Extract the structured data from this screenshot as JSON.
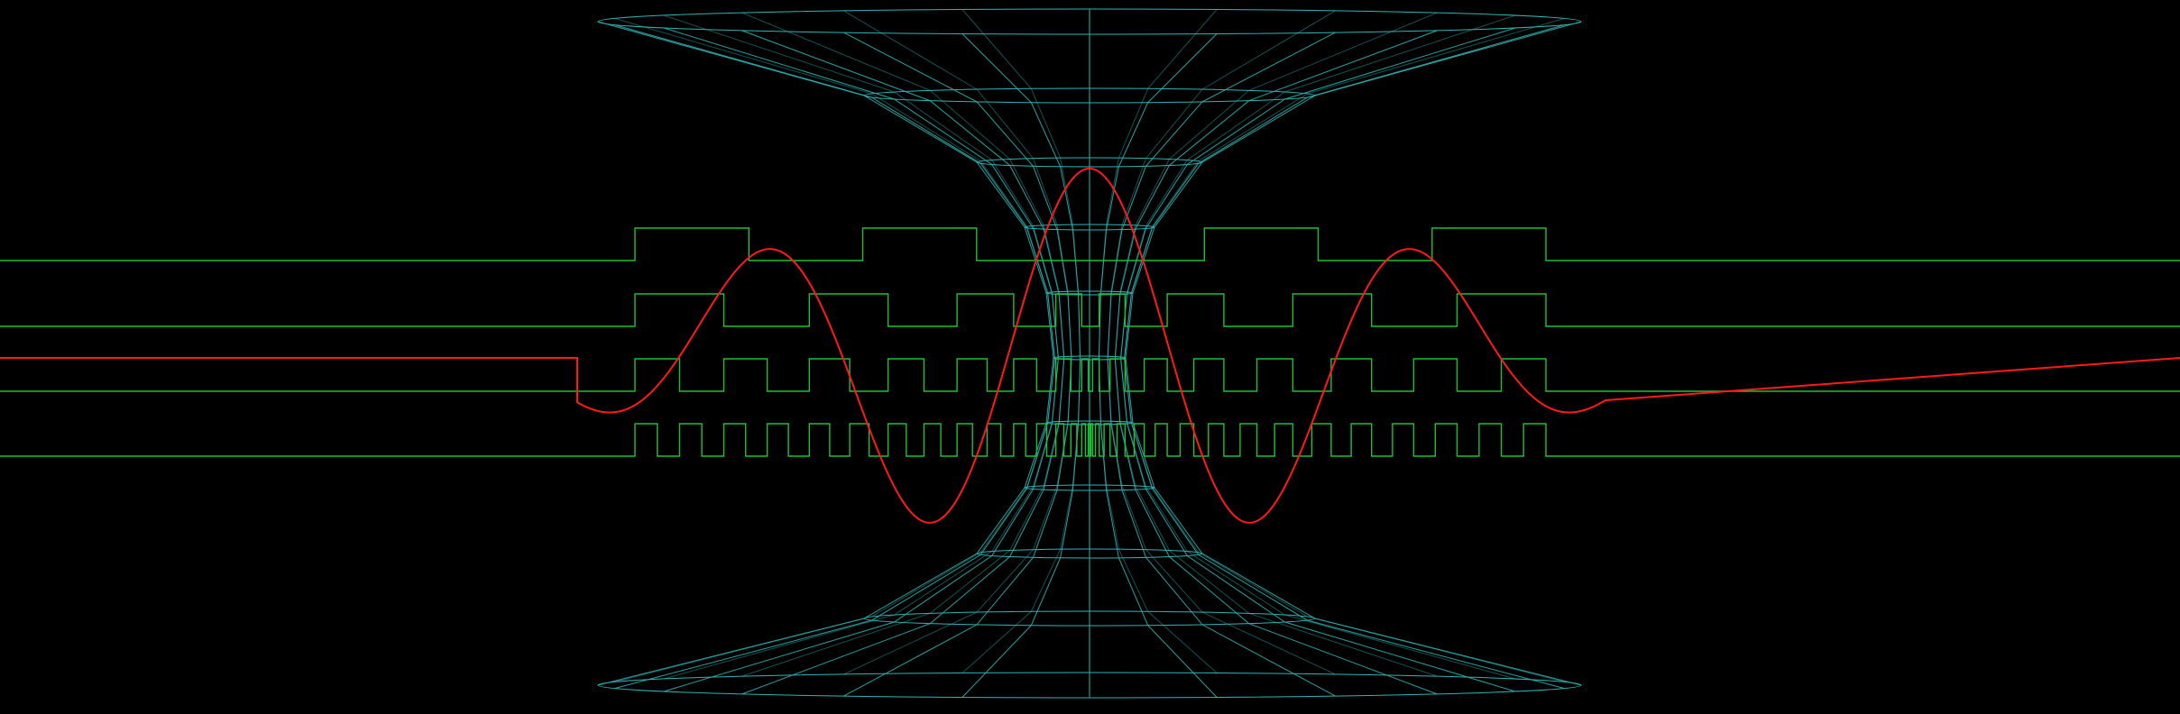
{
  "scene": {
    "background": "#000000",
    "colors": {
      "wireframe": "#2fb3b3",
      "square_waves": "#1fbf3a",
      "sine_wave": "#ff1a1a"
    },
    "square_wave_rows": [
      {
        "name": "row-1",
        "cycles_each_side": 2,
        "pattern": "uniform"
      },
      {
        "name": "row-2",
        "cycles_each_side": 4,
        "pattern": "chirp"
      },
      {
        "name": "row-3",
        "cycles_each_side": 8,
        "pattern": "chirp"
      },
      {
        "name": "row-4",
        "cycles_each_side": 16,
        "pattern": "chirp"
      }
    ]
  }
}
